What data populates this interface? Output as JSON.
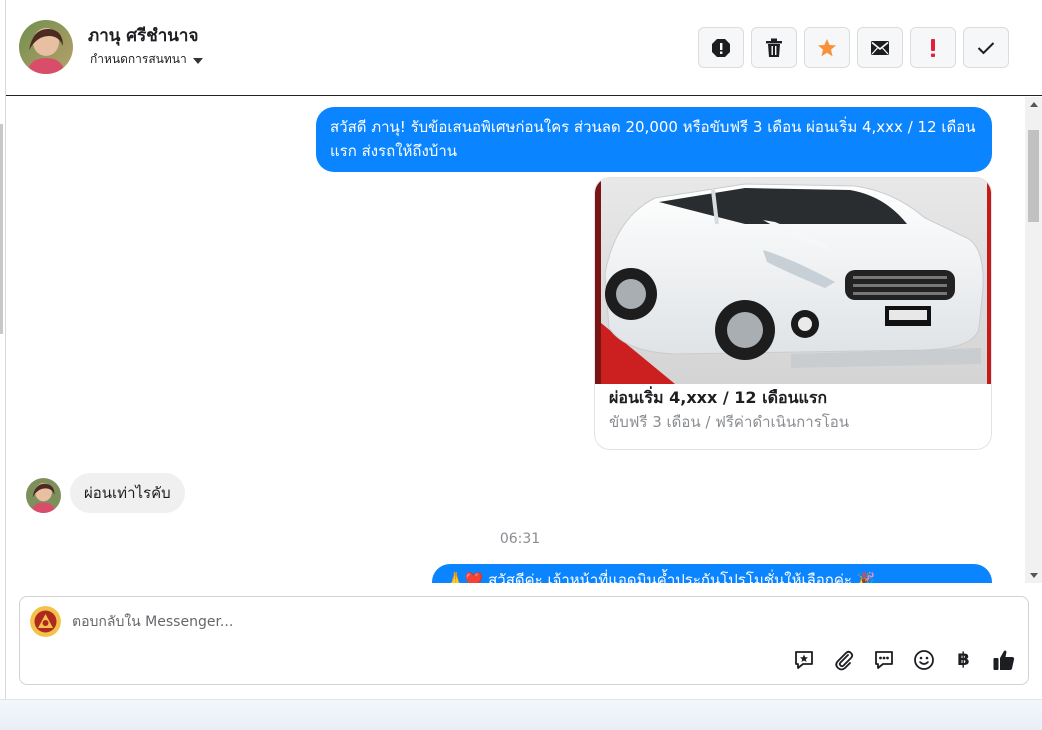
{
  "header": {
    "contact_name": "ภานุ ศรีชำนาจ",
    "assign_label": "กำหนดการสนทนา",
    "actions": [
      {
        "icon": "alert-circle-icon",
        "name": "report-button"
      },
      {
        "icon": "trash-icon",
        "name": "delete-button"
      },
      {
        "icon": "star-icon",
        "name": "star-button"
      },
      {
        "icon": "mail-icon",
        "name": "mark-unread-button"
      },
      {
        "icon": "exclamation-icon",
        "name": "spam-button"
      },
      {
        "icon": "check-icon",
        "name": "mark-done-button"
      }
    ]
  },
  "conversation": {
    "messages": [
      {
        "direction": "outgoing",
        "text": "สวัสดี ภานุ! รับข้อเสนอพิเศษก่อนใคร ส่วนลด 20,000 หรือขับฟรี 3 เดือน ผ่อนเริ่ม 4,xxx / 12 เดือนแรก ส่งรถให้ถึงบ้าน"
      },
      {
        "direction": "incoming",
        "text": "ผ่อนเท่าไรคับ"
      },
      {
        "direction": "outgoing",
        "text": "🙏❤️ สวัสดีค่ะ เจ้าหน้าที่แอดมินค้ำประกันโปรโมชั่นให้เลือกค่ะ 🎉"
      }
    ],
    "card": {
      "title": "ผ่อนเริ่ม 4,xxx / 12 เดือนแรก",
      "subtitle": "ขับฟรี 3 เดือน / ฟรีค่าดำเนินการโอน"
    },
    "timestamp": "06:31"
  },
  "composer": {
    "placeholder": "ตอบกลับใน Messenger...",
    "tools": [
      "saved-reply-icon",
      "attachment-icon",
      "chat-bubble-icon",
      "emoji-icon",
      "baht-icon",
      "thumbs-up-icon"
    ],
    "baht_symbol": "฿"
  },
  "colors": {
    "outgoing_bubble": "#0a84ff",
    "incoming_bubble": "#f0f0f0",
    "star": "#f7923a",
    "spam": "#e41e3f"
  }
}
